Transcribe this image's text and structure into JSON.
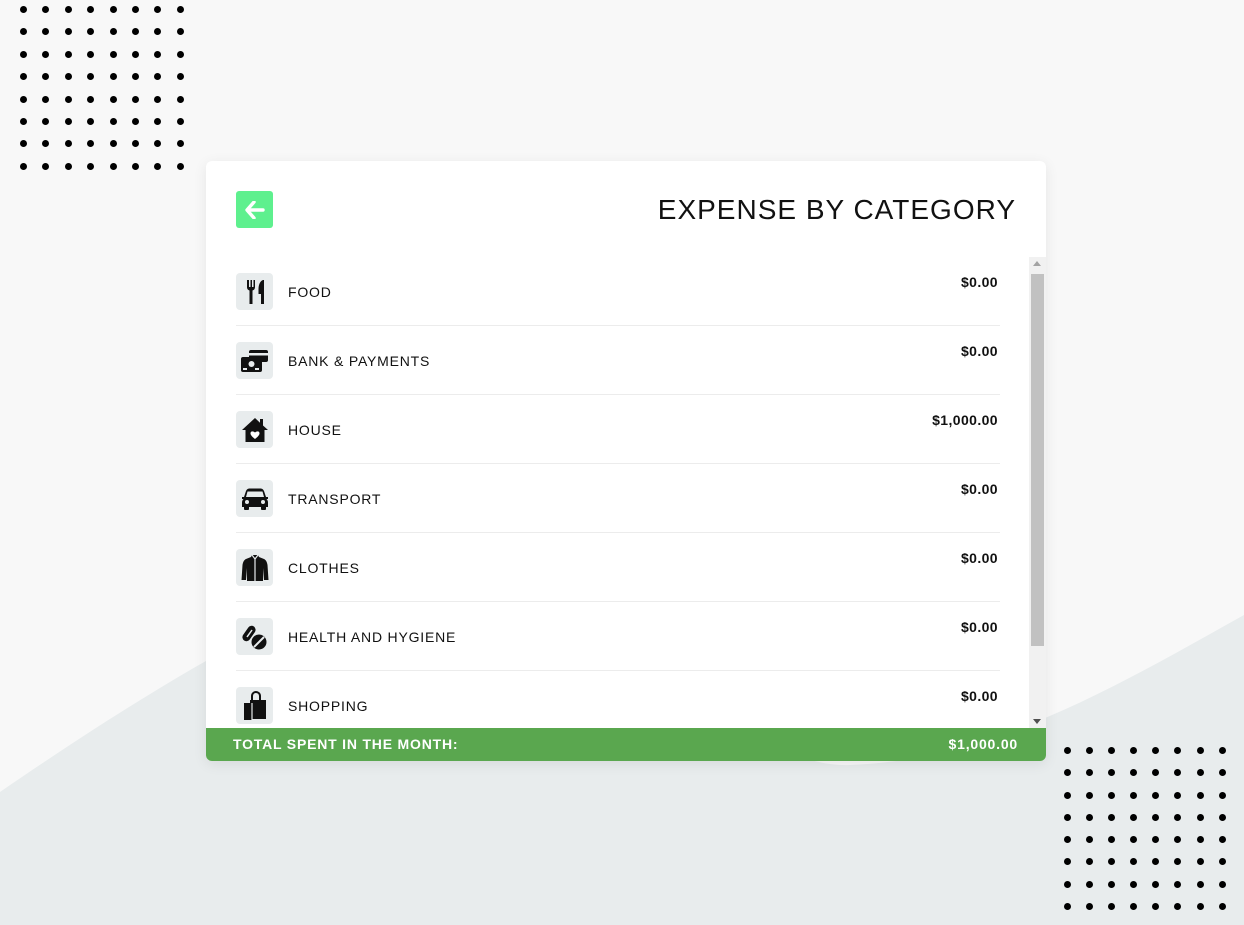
{
  "header": {
    "title": "EXPENSE BY CATEGORY",
    "back_icon": "arrow-left-icon",
    "accent_color": "#5ef08e"
  },
  "categories": [
    {
      "label": "FOOD",
      "amount": "$0.00",
      "icon": "fork-knife-icon"
    },
    {
      "label": "BANK & PAYMENTS",
      "amount": "$0.00",
      "icon": "credit-card-icon"
    },
    {
      "label": "HOUSE",
      "amount": "$1,000.00",
      "icon": "house-icon"
    },
    {
      "label": "TRANSPORT",
      "amount": "$0.00",
      "icon": "car-icon"
    },
    {
      "label": "CLOTHES",
      "amount": "$0.00",
      "icon": "jacket-icon"
    },
    {
      "label": "HEALTH AND HYGIENE",
      "amount": "$0.00",
      "icon": "pills-icon"
    },
    {
      "label": "SHOPPING",
      "amount": "$0.00",
      "icon": "shopping-bag-icon"
    }
  ],
  "footer": {
    "label": "TOTAL SPENT IN THE MONTH:",
    "total": "$1,000.00",
    "color": "#5aa74f"
  }
}
